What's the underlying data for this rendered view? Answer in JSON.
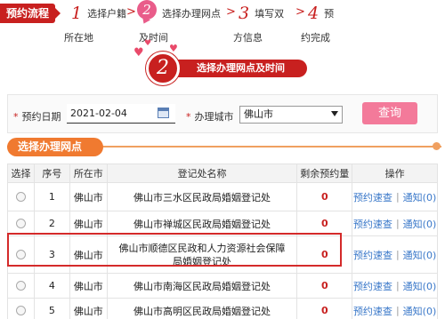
{
  "flow": {
    "tag": "预约流程",
    "steps": [
      {
        "num": "1",
        "label": "选择户籍"
      },
      {
        "num": "2",
        "label": "选择办理网点"
      },
      {
        "num": "3",
        "label": "填写双"
      },
      {
        "num": "4",
        "label": "预"
      }
    ],
    "sublabels": [
      "所在地",
      "及时间",
      "方信息",
      "约完成"
    ]
  },
  "banner": {
    "num": "2",
    "text": "选择办理网点及时间"
  },
  "form": {
    "date_label": "预约日期",
    "date_value": "2021-02-04",
    "city_label": "办理城市",
    "city_value": "佛山市",
    "query_label": "查询"
  },
  "section_title": "选择办理网点",
  "table": {
    "headers": [
      "选择",
      "序号",
      "所在市",
      "登记处名称",
      "剩余预约量",
      "操作"
    ],
    "rows": [
      {
        "no": "1",
        "city": "佛山市",
        "name": "佛山市三水区民政局婚姻登记处",
        "count": "0",
        "link1": "预约速查",
        "link2": "通知(0)"
      },
      {
        "no": "2",
        "city": "佛山市",
        "name": "佛山市禅城区民政局婚姻登记处",
        "count": "0",
        "link1": "预约速查",
        "link2": "通知(0)"
      },
      {
        "no": "3",
        "city": "佛山市",
        "name": "佛山市顺德区民政和人力资源社会保障局婚姻登记处",
        "count": "0",
        "link1": "预约速查",
        "link2": "通知(0)"
      },
      {
        "no": "4",
        "city": "佛山市",
        "name": "佛山市南海区民政局婚姻登记处",
        "count": "0",
        "link1": "预约速查",
        "link2": "通知(0)"
      },
      {
        "no": "5",
        "city": "佛山市",
        "name": "佛山市高明区民政局婚姻登记处",
        "count": "0",
        "link1": "预约速查",
        "link2": "通知(0)"
      }
    ]
  },
  "colors": {
    "accent_red": "#c8201f",
    "pink_button": "#f37a9a",
    "orange_tab": "#f07a30",
    "link_blue": "#3a78c9"
  },
  "icons": {
    "date_picker": "calendar-icon",
    "select": "chevron-down-icon",
    "decor": "heart-icon"
  }
}
